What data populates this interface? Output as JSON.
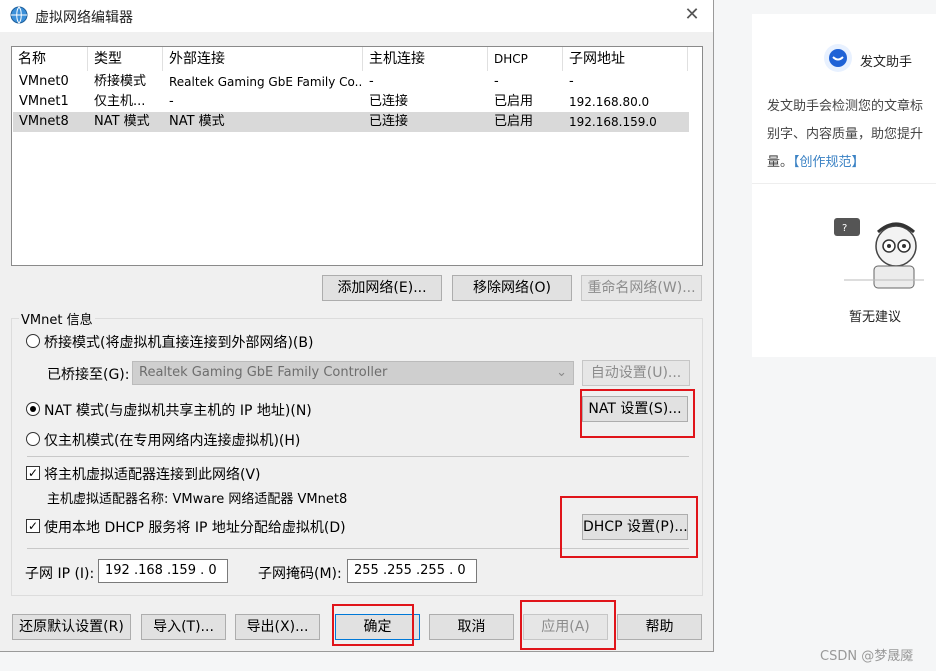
{
  "window": {
    "title": "虚拟网络编辑器",
    "close_symbol": "✕"
  },
  "table": {
    "columns": [
      "名称",
      "类型",
      "外部连接",
      "主机连接",
      "DHCP",
      "子网地址"
    ],
    "rows": [
      [
        "VMnet0",
        "桥接模式",
        "Realtek Gaming GbE Family Co...",
        "-",
        "-",
        "-"
      ],
      [
        "VMnet1",
        "仅主机...",
        "-",
        "已连接",
        "已启用",
        "192.168.80.0"
      ],
      [
        "VMnet8",
        "NAT 模式",
        "NAT 模式",
        "已连接",
        "已启用",
        "192.168.159.0"
      ]
    ],
    "selected_row": 2
  },
  "table_buttons": {
    "add": "添加网络(E)...",
    "remove": "移除网络(O)",
    "rename": "重命名网络(W)..."
  },
  "vmnet_info": {
    "group_label": "VMnet 信息",
    "bridge_mode": "桥接模式(将虚拟机直接连接到外部网络)(B)",
    "bridged_to_label": "已桥接至(G):",
    "bridged_to_value": "Realtek Gaming GbE Family Controller",
    "auto_settings": "自动设置(U)...",
    "nat_mode": "NAT 模式(与虚拟机共享主机的 IP 地址)(N)",
    "nat_settings": "NAT 设置(S)...",
    "host_only_mode": "仅主机模式(在专用网络内连接虚拟机)(H)",
    "connect_adapter": "将主机虚拟适配器连接到此网络(V)",
    "adapter_name": "主机虚拟适配器名称: VMware 网络适配器 VMnet8",
    "use_dhcp": "使用本地 DHCP 服务将 IP 地址分配给虚拟机(D)",
    "dhcp_settings": "DHCP 设置(P)...",
    "subnet_ip_label": "子网 IP (I):",
    "subnet_ip_value": "192 .168 .159 .  0",
    "subnet_mask_label": "子网掩码(M):",
    "subnet_mask_value": "255 .255 .255 .  0",
    "selected_mode": "nat",
    "connect_adapter_checked": true,
    "use_dhcp_checked": true
  },
  "bottom_buttons": {
    "restore": "还原默认设置(R)",
    "import": "导入(T)...",
    "export": "导出(X)...",
    "ok": "确定",
    "cancel": "取消",
    "apply": "应用(A)",
    "help": "帮助"
  },
  "side_panel": {
    "assistant_name": "发文助手",
    "description_prefix": "发文助手会检测您的文章标",
    "description_line2": "别字、内容质量，助您提升",
    "description_line3_prefix": "量。",
    "link": "【创作规范】",
    "empty_label": "暂无建议"
  },
  "watermark": "CSDN @梦晟魇",
  "colors": {
    "highlight_red": "#e0141a",
    "link_blue": "#3b82c4",
    "selected_row": "#d9d9d9"
  }
}
